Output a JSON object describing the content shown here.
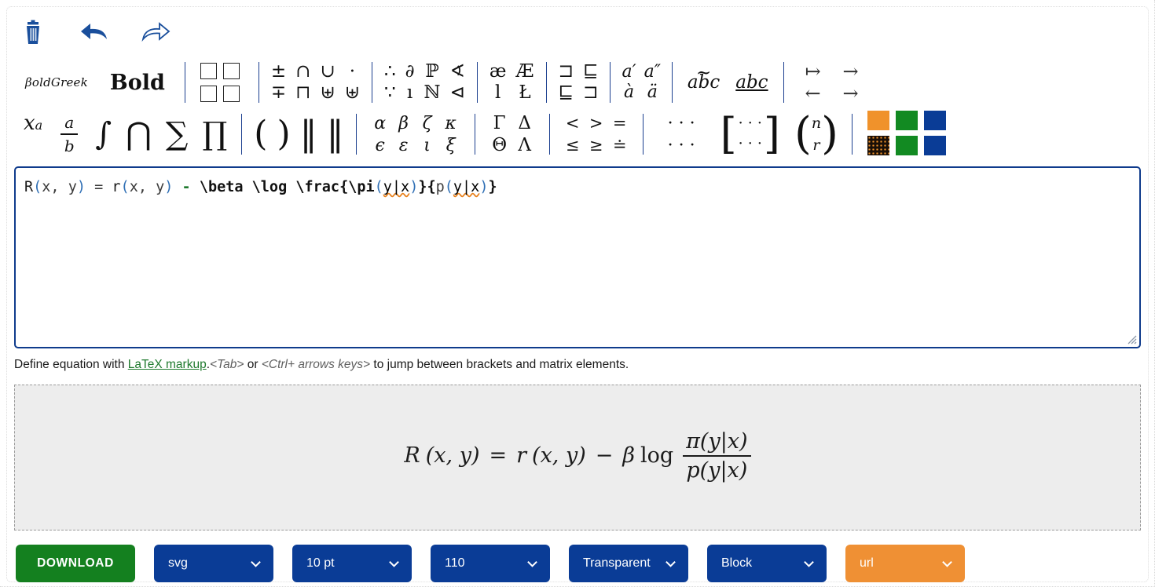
{
  "toolbar": {
    "icons": [
      {
        "name": "delete-icon",
        "label": "Delete"
      },
      {
        "name": "undo-icon",
        "label": "Undo"
      },
      {
        "name": "redo-icon",
        "label": "Redo"
      }
    ],
    "bold_greek_label": "βoldGreek",
    "bold_label": "Bold",
    "matrix_label": "matrix",
    "groups": {
      "operators": [
        "±",
        "∓",
        "∩",
        "⊓",
        "∪",
        "⊎",
        "·",
        "⊎"
      ],
      "operators_row1": [
        "±",
        "∩",
        "∪",
        "·"
      ],
      "operators_row2": [
        "∓",
        "⊓",
        "⊎",
        "⊎"
      ],
      "logic_row1": [
        "∴",
        "∂",
        "ℙ",
        "∢"
      ],
      "logic_row2": [
        "∵",
        "ı",
        "ℕ",
        "⊲"
      ],
      "ligature_row1": [
        "æ",
        "Æ"
      ],
      "ligature_row2": [
        "l",
        "Ł"
      ],
      "bracket_row1": [
        "⊐",
        "⊑"
      ],
      "bracket_row2": [
        "⊑",
        "⊐"
      ],
      "accent_prime": [
        "a′",
        "a″"
      ],
      "accent_dot": [
        "à",
        "ä"
      ],
      "text_tilde": "abc",
      "text_underline": "abc",
      "arrows_row1": [
        "↦",
        "→"
      ],
      "arrows_row2": [
        "←",
        "→"
      ],
      "superscript": "x",
      "superscript_exp": "a",
      "fraction_num": "a",
      "fraction_den": "b",
      "big_ops": [
        "∫",
        "⋂",
        "∑",
        "∏"
      ],
      "delimiters": [
        "(",
        ")",
        "‖",
        "‖"
      ],
      "greek_row1": [
        "α",
        "β",
        "ζ",
        "κ"
      ],
      "greek_row2": [
        "ϵ",
        "ε",
        "ι",
        "ξ"
      ],
      "greek_caps_row1": [
        "Γ",
        "Δ"
      ],
      "greek_caps_row2": [
        "Θ",
        "Λ"
      ],
      "compare_row1": [
        "<",
        ">",
        "="
      ],
      "compare_row2": [
        "≤",
        "≥",
        "≐"
      ],
      "dots_row1": "· · ·",
      "dots_row2": "· · ·",
      "bmatrix_row1": "· · ·",
      "bmatrix_row2": "· · ·",
      "binom_top": "n",
      "binom_bottom": "r"
    },
    "colors": {
      "orange": "#f0922b",
      "green": "#128a22",
      "blue": "#0a3c96",
      "pattern": "#1a0f07"
    }
  },
  "editor": {
    "tokens": [
      {
        "t": "R",
        "c": "id"
      },
      {
        "t": "(",
        "c": "punct"
      },
      {
        "t": "x,",
        "c": "plain"
      },
      {
        "t": " y",
        "c": "plain"
      },
      {
        "t": ")",
        "c": "punct"
      },
      {
        "t": " = ",
        "c": "plain"
      },
      {
        "t": "r",
        "c": "id"
      },
      {
        "t": "(",
        "c": "punct"
      },
      {
        "t": "x,",
        "c": "plain"
      },
      {
        "t": " y",
        "c": "plain"
      },
      {
        "t": ")",
        "c": "punct"
      },
      {
        "t": " ",
        "c": "plain"
      },
      {
        "t": "-",
        "c": "op"
      },
      {
        "t": " ",
        "c": "plain"
      },
      {
        "t": "\\beta",
        "c": "cmd"
      },
      {
        "t": " ",
        "c": "plain"
      },
      {
        "t": "\\log",
        "c": "cmd"
      },
      {
        "t": " ",
        "c": "plain"
      },
      {
        "t": "\\frac",
        "c": "cmd"
      },
      {
        "t": "{",
        "c": "brace"
      },
      {
        "t": "\\pi",
        "c": "cmd"
      },
      {
        "t": "(",
        "c": "punct"
      },
      {
        "t": "y|x",
        "c": "spell"
      },
      {
        "t": ")",
        "c": "punct"
      },
      {
        "t": "}",
        "c": "brace"
      },
      {
        "t": "{",
        "c": "brace"
      },
      {
        "t": "p",
        "c": "plain"
      },
      {
        "t": "(",
        "c": "punct"
      },
      {
        "t": "y|x",
        "c": "spell"
      },
      {
        "t": ")",
        "c": "punct"
      },
      {
        "t": "}",
        "c": "brace"
      }
    ],
    "raw": "R(x, y) = r(x, y) - \\beta \\log \\frac{\\pi(y|x)}{p(y|x)}"
  },
  "hint": {
    "prefix": "Define equation with ",
    "link": "LaTeX markup",
    "after_link": ".",
    "key_tab": "<Tab>",
    "mid": " or ",
    "key_ctrl": "<Ctrl+ arrows keys>",
    "suffix": " to jump between brackets and matrix elements."
  },
  "preview": {
    "lhs_fn": "R",
    "lhs_args": "(x, y)",
    "equals": "=",
    "rhs_fn": "r",
    "rhs_args": "(x, y)",
    "minus": "−",
    "beta": "β",
    "log": "log",
    "numerator": "π(y|x)",
    "denominator": "p(y|x)"
  },
  "bottom": {
    "download_label": "DOWNLOAD",
    "selects": [
      {
        "name": "format-select",
        "value": "svg"
      },
      {
        "name": "fontsize-select",
        "value": "10 pt"
      },
      {
        "name": "scale-select",
        "value": "110"
      },
      {
        "name": "background-select",
        "value": "Transparent"
      },
      {
        "name": "display-select",
        "value": "Block"
      },
      {
        "name": "output-select",
        "value": "url"
      }
    ]
  }
}
